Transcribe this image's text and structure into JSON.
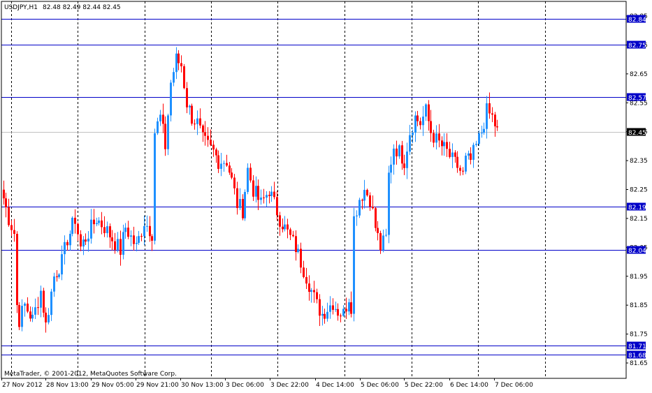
{
  "header": {
    "symbol": "USDJPY,H1",
    "ohlc": "82.48 82.49 82.44 82.45"
  },
  "copyright": "MetaTrader, © 2001-2012, MetaQuotes Software Corp.",
  "colors": {
    "background": "#ffffff",
    "axis": "#000000",
    "grid": "#000000",
    "bull": "#1e90ff",
    "bear": "#ff0000",
    "hline": "#0000c8",
    "hline_label_bg": "#0000c8",
    "bid_line": "#c0c0c0"
  },
  "chart_data": {
    "type": "candlestick",
    "symbol": "USDJPY",
    "timeframe": "H1",
    "title": "USDJPY,H1",
    "ylim": [
      81.63,
      82.87
    ],
    "y_ticks": [
      "82.85",
      "82.75",
      "82.65",
      "82.55",
      "82.45",
      "82.35",
      "82.25",
      "82.15",
      "82.05",
      "81.95",
      "81.85",
      "81.75",
      "81.65"
    ],
    "x_ticks": [
      "27 Nov 2012",
      "28 Nov 13:00",
      "29 Nov 05:00",
      "29 Nov 21:00",
      "30 Nov 13:00",
      "3 Dec 06:00",
      "3 Dec 22:00",
      "4 Dec 14:00",
      "5 Dec 06:00",
      "5 Dec 22:00",
      "6 Dec 14:00",
      "7 Dec 06:00"
    ],
    "grid": "vertical dotted",
    "horizontal_lines": [
      {
        "value": 82.84,
        "label": "82.84"
      },
      {
        "value": 82.75,
        "label": "82.75"
      },
      {
        "value": 82.57,
        "label": "82.57"
      },
      {
        "value": 82.19,
        "label": "82.19"
      },
      {
        "value": 82.04,
        "label": "82.04"
      },
      {
        "value": 81.71,
        "label": "81.71"
      },
      {
        "value": 81.68,
        "label": "81.68"
      }
    ],
    "current_price": {
      "value": 82.45,
      "label": "82.45"
    },
    "keypoints": [
      [
        0,
        82.22
      ],
      [
        2,
        82.15
      ],
      [
        4,
        82.1
      ],
      [
        5,
        81.85
      ],
      [
        6,
        81.8
      ],
      [
        8,
        81.85
      ],
      [
        11,
        81.8
      ],
      [
        14,
        81.9
      ],
      [
        16,
        81.78
      ],
      [
        19,
        81.95
      ],
      [
        22,
        82.0
      ],
      [
        24,
        82.08
      ],
      [
        25,
        82.1
      ],
      [
        27,
        82.15
      ],
      [
        29,
        82.05
      ],
      [
        32,
        82.1
      ],
      [
        35,
        82.15
      ],
      [
        38,
        82.12
      ],
      [
        41,
        82.08
      ],
      [
        44,
        82.04
      ],
      [
        46,
        82.12
      ],
      [
        50,
        82.05
      ],
      [
        53,
        82.14
      ],
      [
        56,
        82.1
      ],
      [
        57,
        82.45
      ],
      [
        59,
        82.5
      ],
      [
        61,
        82.4
      ],
      [
        63,
        82.62
      ],
      [
        65,
        82.7
      ],
      [
        67,
        82.68
      ],
      [
        69,
        82.55
      ],
      [
        71,
        82.5
      ],
      [
        73,
        82.48
      ],
      [
        75,
        82.42
      ],
      [
        77,
        82.4
      ],
      [
        79,
        82.38
      ],
      [
        81,
        82.35
      ],
      [
        84,
        82.35
      ],
      [
        86,
        82.28
      ],
      [
        88,
        82.2
      ],
      [
        90,
        82.18
      ],
      [
        92,
        82.32
      ],
      [
        94,
        82.25
      ],
      [
        97,
        82.2
      ],
      [
        100,
        82.25
      ],
      [
        102,
        82.2
      ],
      [
        104,
        82.15
      ],
      [
        107,
        82.1
      ],
      [
        110,
        82.05
      ],
      [
        112,
        82.0
      ],
      [
        114,
        81.95
      ],
      [
        116,
        81.9
      ],
      [
        118,
        81.85
      ],
      [
        120,
        81.82
      ],
      [
        122,
        81.84
      ],
      [
        124,
        81.86
      ],
      [
        126,
        81.83
      ],
      [
        128,
        81.82
      ],
      [
        130,
        81.88
      ],
      [
        131,
        81.85
      ],
      [
        132,
        82.15
      ],
      [
        134,
        82.22
      ],
      [
        136,
        82.25
      ],
      [
        138,
        82.22
      ],
      [
        140,
        82.12
      ],
      [
        142,
        82.05
      ],
      [
        144,
        82.08
      ],
      [
        145,
        82.3
      ],
      [
        147,
        82.4
      ],
      [
        149,
        82.38
      ],
      [
        151,
        82.35
      ],
      [
        153,
        82.45
      ],
      [
        155,
        82.5
      ],
      [
        157,
        82.48
      ],
      [
        159,
        82.52
      ],
      [
        161,
        82.45
      ],
      [
        163,
        82.42
      ],
      [
        165,
        82.4
      ],
      [
        167,
        82.38
      ],
      [
        169,
        82.35
      ],
      [
        171,
        82.33
      ],
      [
        173,
        82.3
      ],
      [
        174,
        82.35
      ],
      [
        176,
        82.35
      ],
      [
        178,
        82.4
      ],
      [
        180,
        82.45
      ],
      [
        182,
        82.52
      ],
      [
        184,
        82.5
      ],
      [
        186,
        82.45
      ]
    ]
  }
}
